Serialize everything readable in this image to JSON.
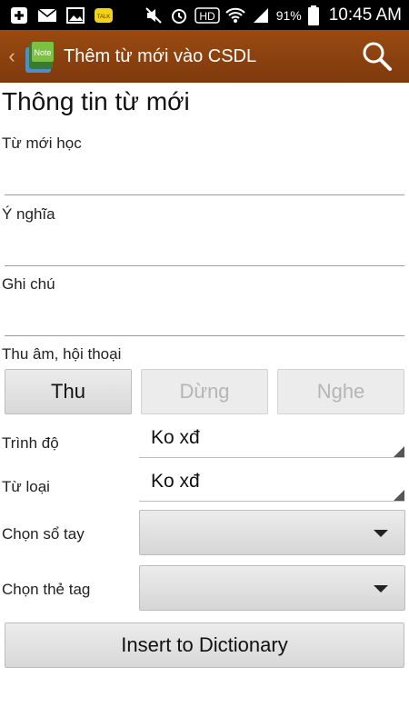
{
  "statusbar": {
    "battery": "91%",
    "time": "10:45 AM",
    "hd": "HD",
    "icons": [
      "plus-icon",
      "mail-icon",
      "image-icon",
      "talk-icon",
      "mute-icon",
      "alarm-icon",
      "wifi-icon",
      "signal-icon",
      "battery-icon"
    ]
  },
  "actionbar": {
    "title": "Thêm từ mới vào CSDL",
    "logo_badge": "Note"
  },
  "form": {
    "section_title": "Thông tin từ mới",
    "word_label": "Từ mới học",
    "meaning_label": "Ý nghĩa",
    "note_label": "Ghi chú",
    "word_value": "",
    "meaning_value": "",
    "note_value": "",
    "record_label": "Thu âm, hội thoại",
    "buttons": {
      "record": "Thu",
      "stop": "Dừng",
      "play": "Nghe"
    },
    "level_label": "Trình độ",
    "level_value": "Ko xđ",
    "wordtype_label": "Từ loại",
    "wordtype_value": "Ko xđ",
    "notebook_label": "Chọn sổ tay",
    "tag_label": "Chọn thẻ tag",
    "insert_button": "Insert to Dictionary"
  },
  "colors": {
    "actionbar": "#8a410f",
    "statusbar": "#000000"
  }
}
